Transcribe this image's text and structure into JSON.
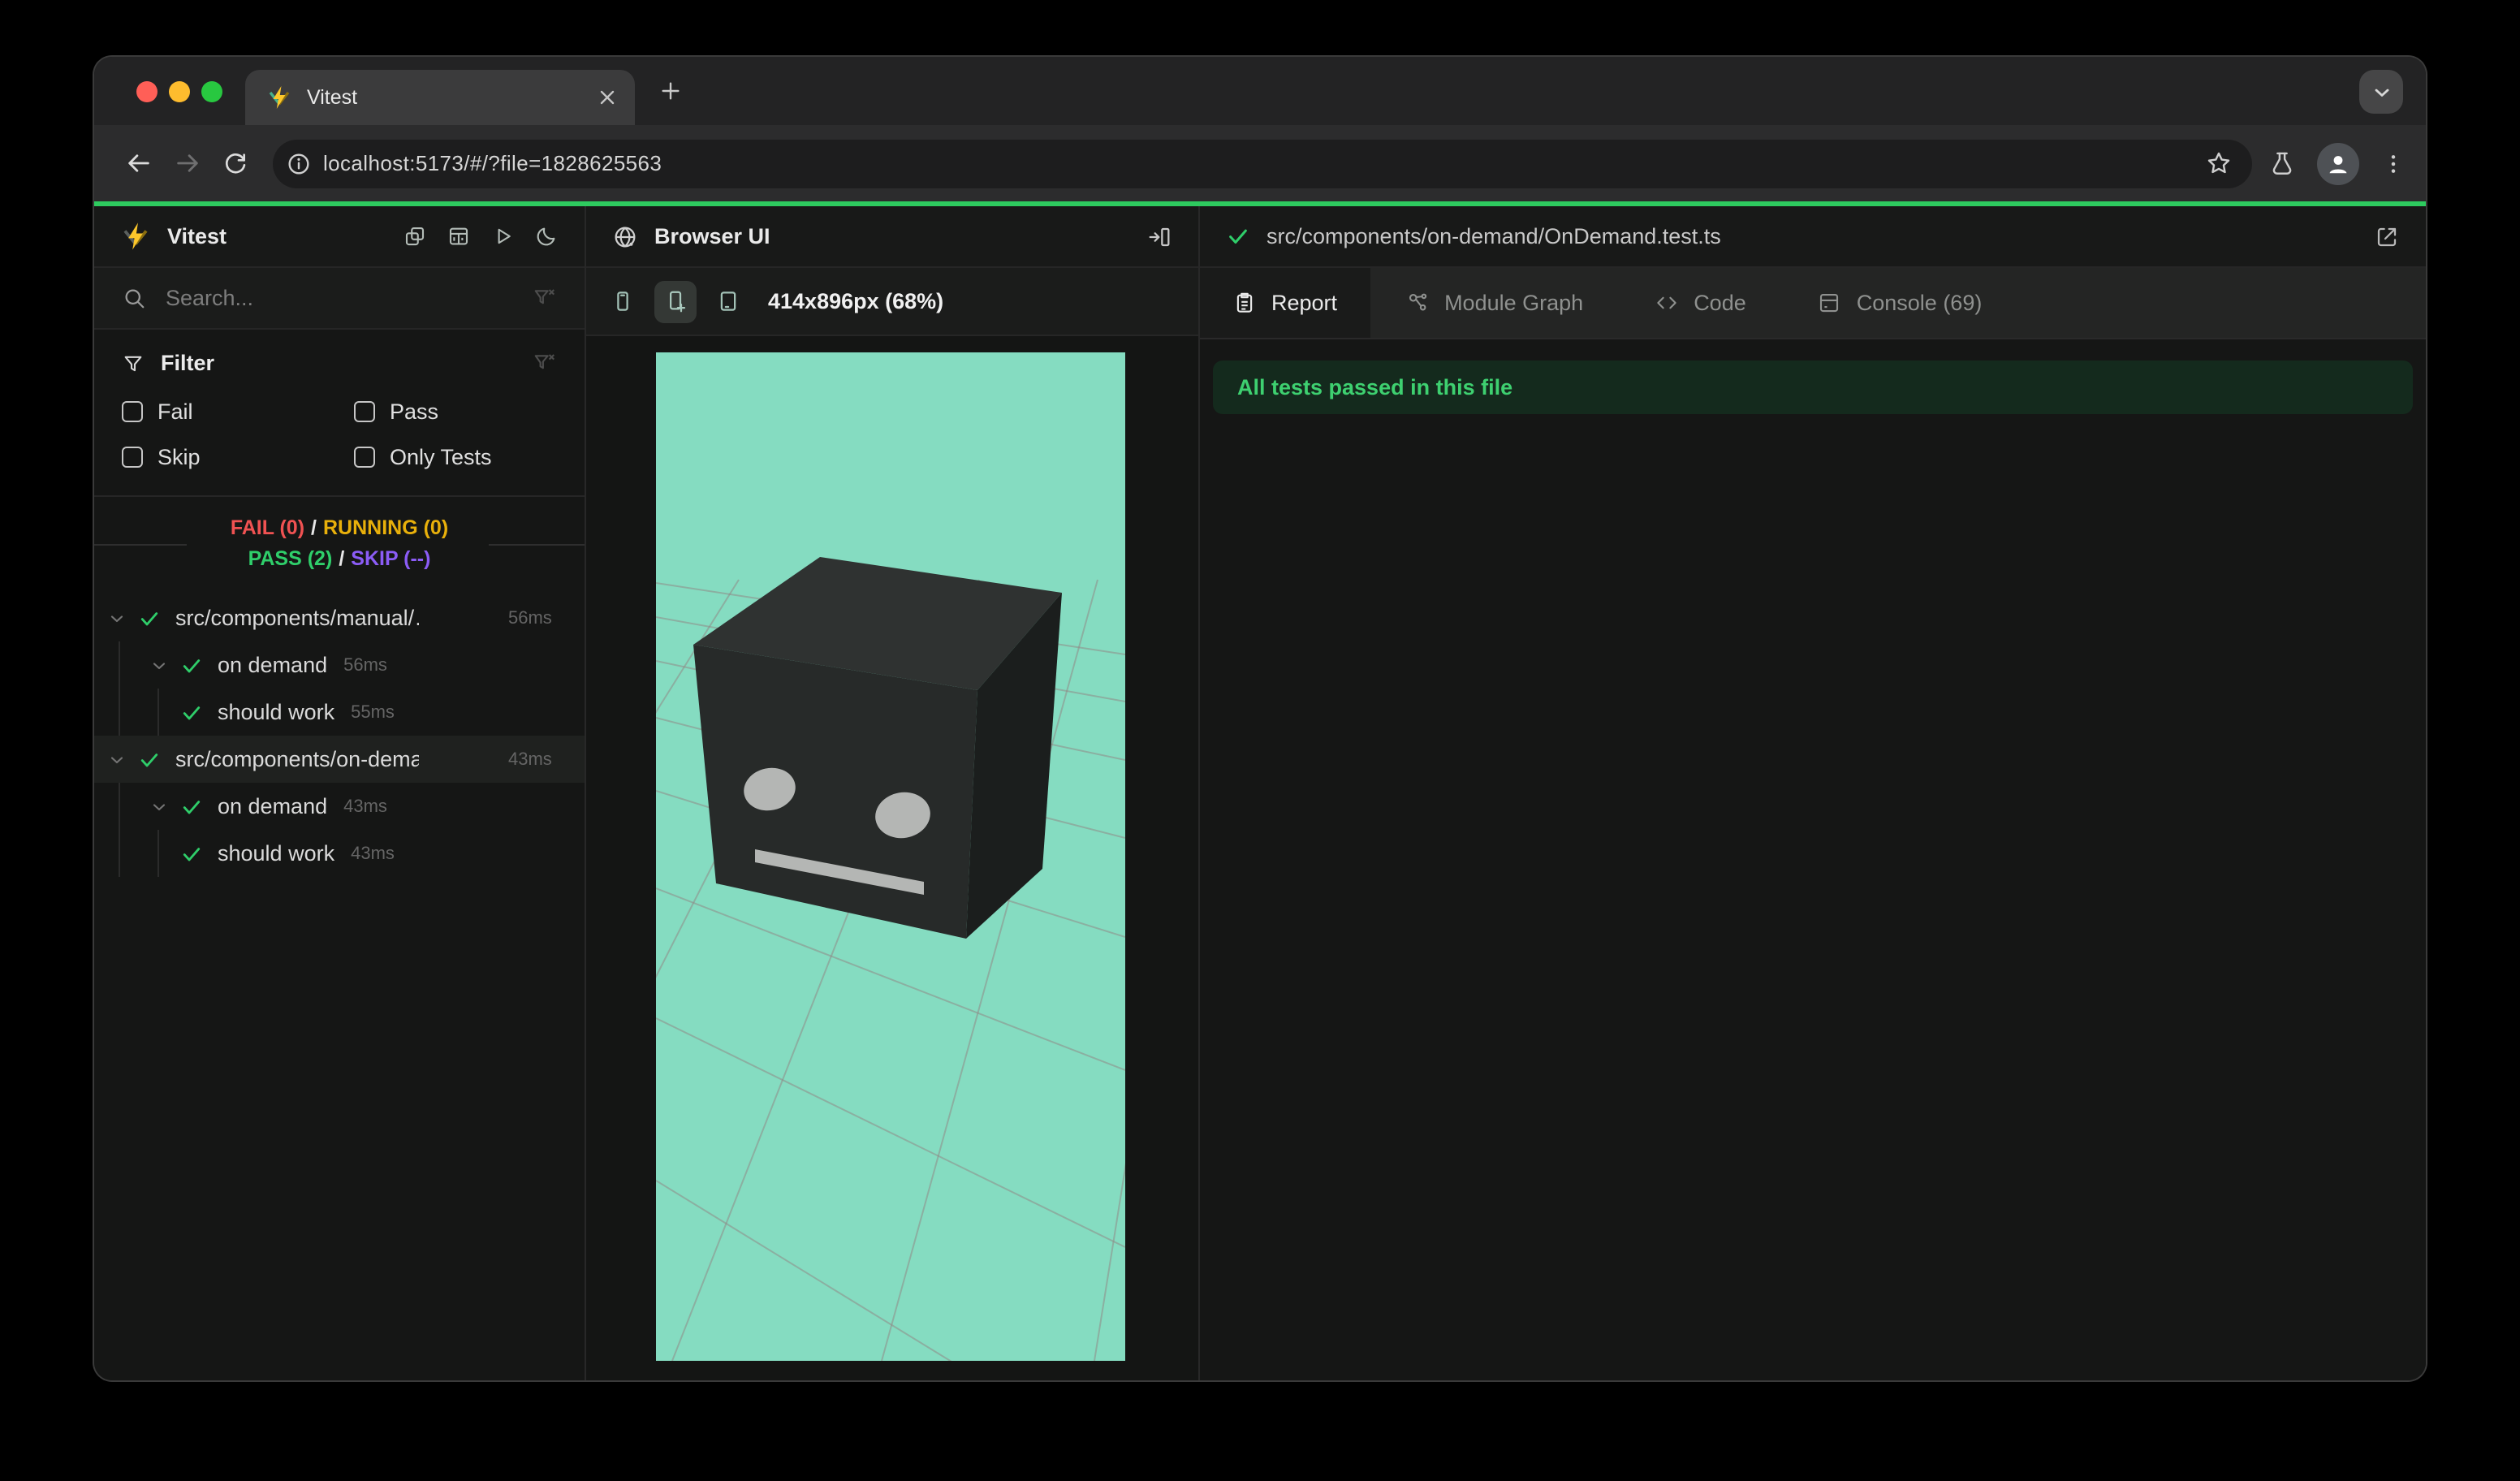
{
  "chrome": {
    "tab_title": "Vitest",
    "url": "localhost:5173/#/?file=1828625563"
  },
  "sidebar": {
    "app_title": "Vitest",
    "search_placeholder": "Search...",
    "filter_title": "Filter",
    "filter_options": [
      "Fail",
      "Pass",
      "Skip",
      "Only Tests"
    ],
    "summary": {
      "fail": "FAIL (0)",
      "slash1": "/",
      "running": "RUNNING (0)",
      "pass": "PASS (2)",
      "slash2": "/",
      "skip": "SKIP (--)"
    },
    "tree": [
      {
        "label": "src/components/manual/…",
        "duration": "56ms"
      },
      {
        "label": "on demand",
        "duration": "56ms"
      },
      {
        "label": "should work",
        "duration": "55ms"
      },
      {
        "label": "src/components/on-dema…",
        "duration": "43ms"
      },
      {
        "label": "on demand",
        "duration": "43ms"
      },
      {
        "label": "should work",
        "duration": "43ms"
      }
    ]
  },
  "browser_panel": {
    "title": "Browser UI",
    "viewport_label": "414x896px (68%)",
    "preview_scene": {
      "background": "#85dcc1",
      "object": "robot-head-cube-on-grid"
    }
  },
  "detail_panel": {
    "file_path": "src/components/on-demand/OnDemand.test.ts",
    "tabs": [
      {
        "label": "Report",
        "active": true
      },
      {
        "label": "Module Graph",
        "active": false
      },
      {
        "label": "Code",
        "active": false
      },
      {
        "label": "Console (69)",
        "active": false
      }
    ],
    "banner_text": "All tests passed in this file"
  },
  "colors": {
    "accent_green": "#2ecb5f",
    "mint_scene": "#85dcc1",
    "fail_red": "#f05252",
    "running_yellow": "#e8b00b",
    "pass_green": "#2fce6a",
    "skip_purple": "#8b5cf6",
    "banner_bg": "#142a1d",
    "banner_text": "#3ed070",
    "vitest_yellow": "#fcc72b"
  }
}
